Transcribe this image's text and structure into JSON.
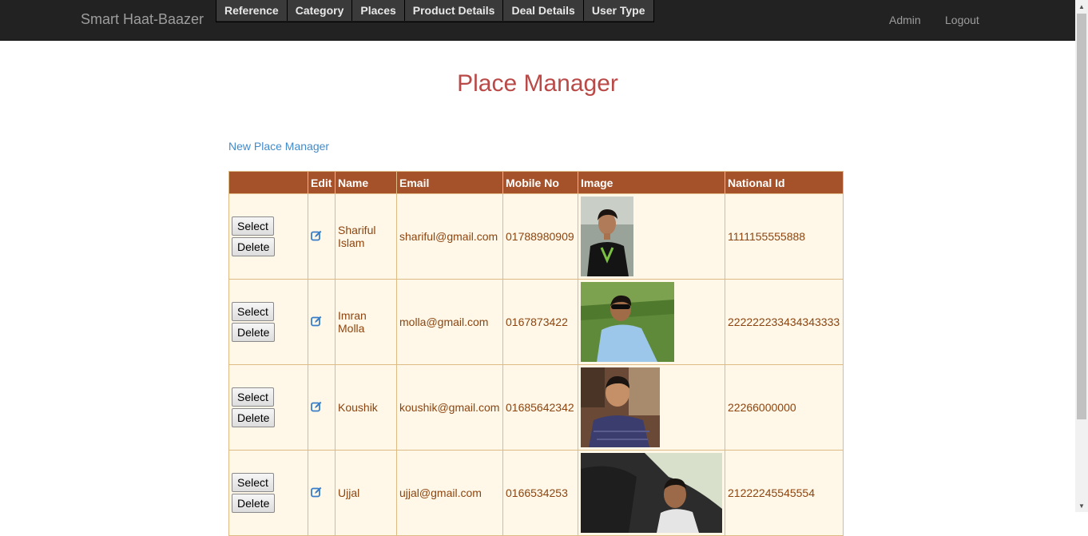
{
  "navbar": {
    "brand": "Smart Haat-Baazer",
    "menu": [
      "Reference",
      "Category",
      "Places",
      "Product Details",
      "Deal Details",
      "User Type"
    ],
    "admin": "Admin",
    "logout": "Logout"
  },
  "page": {
    "title": "Place Manager",
    "new_link": "New Place Manager"
  },
  "table": {
    "headers": [
      "",
      "Edit",
      "Name",
      "Email",
      "Mobile No",
      "Image",
      "National Id"
    ],
    "select_label": "Select",
    "delete_label": "Delete",
    "rows": [
      {
        "name": "Shariful Islam",
        "email": "shariful@gmail.com",
        "mobile": "01788980909",
        "national_id": "1111155555888"
      },
      {
        "name": "Imran Molla",
        "email": "molla@gmail.com",
        "mobile": "0167873422",
        "national_id": "222222233434343333"
      },
      {
        "name": "Koushik",
        "email": "koushik@gmail.com",
        "mobile": "01685642342",
        "national_id": "22266000000"
      },
      {
        "name": "Ujjal",
        "email": "ujjal@gmail.com",
        "mobile": "0166534253",
        "national_id": "21222245545554"
      }
    ]
  },
  "colors": {
    "header_bg": "#a55129",
    "row_bg": "#fff7e7",
    "row_text": "#8c4510",
    "title": "#b94a48",
    "link": "#428bca"
  }
}
